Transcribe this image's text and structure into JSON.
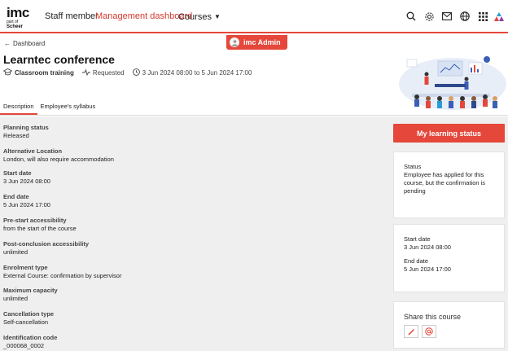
{
  "logo": {
    "main": "imc",
    "sub_prefix": "part of",
    "sub_brand": "Scheer"
  },
  "nav": {
    "links": [
      "Staff member",
      "Management dashboard",
      "Courses"
    ],
    "active_index": 1,
    "icons": [
      "search-icon",
      "settings-icon",
      "mail-icon",
      "globe-icon",
      "apps-grid-icon",
      "brand-logo-icon"
    ]
  },
  "admin_badge": "imc Admin",
  "breadcrumb": {
    "back_label": "Dashboard"
  },
  "course": {
    "title": "Learntec conference",
    "type": "Classroom training",
    "status": "Requested",
    "date_range": "3 Jun 2024 08:00 to 5 Jun 2024 17:00"
  },
  "tabs": [
    "Description",
    "Employee's syllabus"
  ],
  "active_tab": 0,
  "fields": [
    {
      "label": "Planning status",
      "value": "Released"
    },
    {
      "label": "Alternative Location",
      "value": "London, will also require accommodation"
    },
    {
      "label": "Start date",
      "value": "3 Jun 2024 08:00"
    },
    {
      "label": "End date",
      "value": "5 Jun 2024 17:00"
    },
    {
      "label": "Pre-start accessibility",
      "value": "from the start of the course"
    },
    {
      "label": "Post-conclusion accessibility",
      "value": "unlimited"
    },
    {
      "label": "Enrolment type",
      "value": "External Course: confirmation by supervisor"
    },
    {
      "label": "Maximum capacity",
      "value": "unlimited"
    },
    {
      "label": "Cancellation type",
      "value": "Self-cancellation"
    },
    {
      "label": "Identification code",
      "value": "_000068_0002"
    }
  ],
  "sidebar": {
    "status_button": "My learning status",
    "status_card": {
      "label": "Status",
      "value": "Employee has applied for this course, but the confirmation is pending"
    },
    "dates_card": {
      "start_label": "Start date",
      "start_value": "3 Jun 2024 08:00",
      "end_label": "End date",
      "end_value": "5 Jun 2024 17:00"
    },
    "share": {
      "title": "Share this course",
      "icons": [
        "edit-pencil-icon",
        "at-sign-icon"
      ]
    }
  },
  "colors": {
    "accent": "#e5473b",
    "background": "#efefef"
  }
}
